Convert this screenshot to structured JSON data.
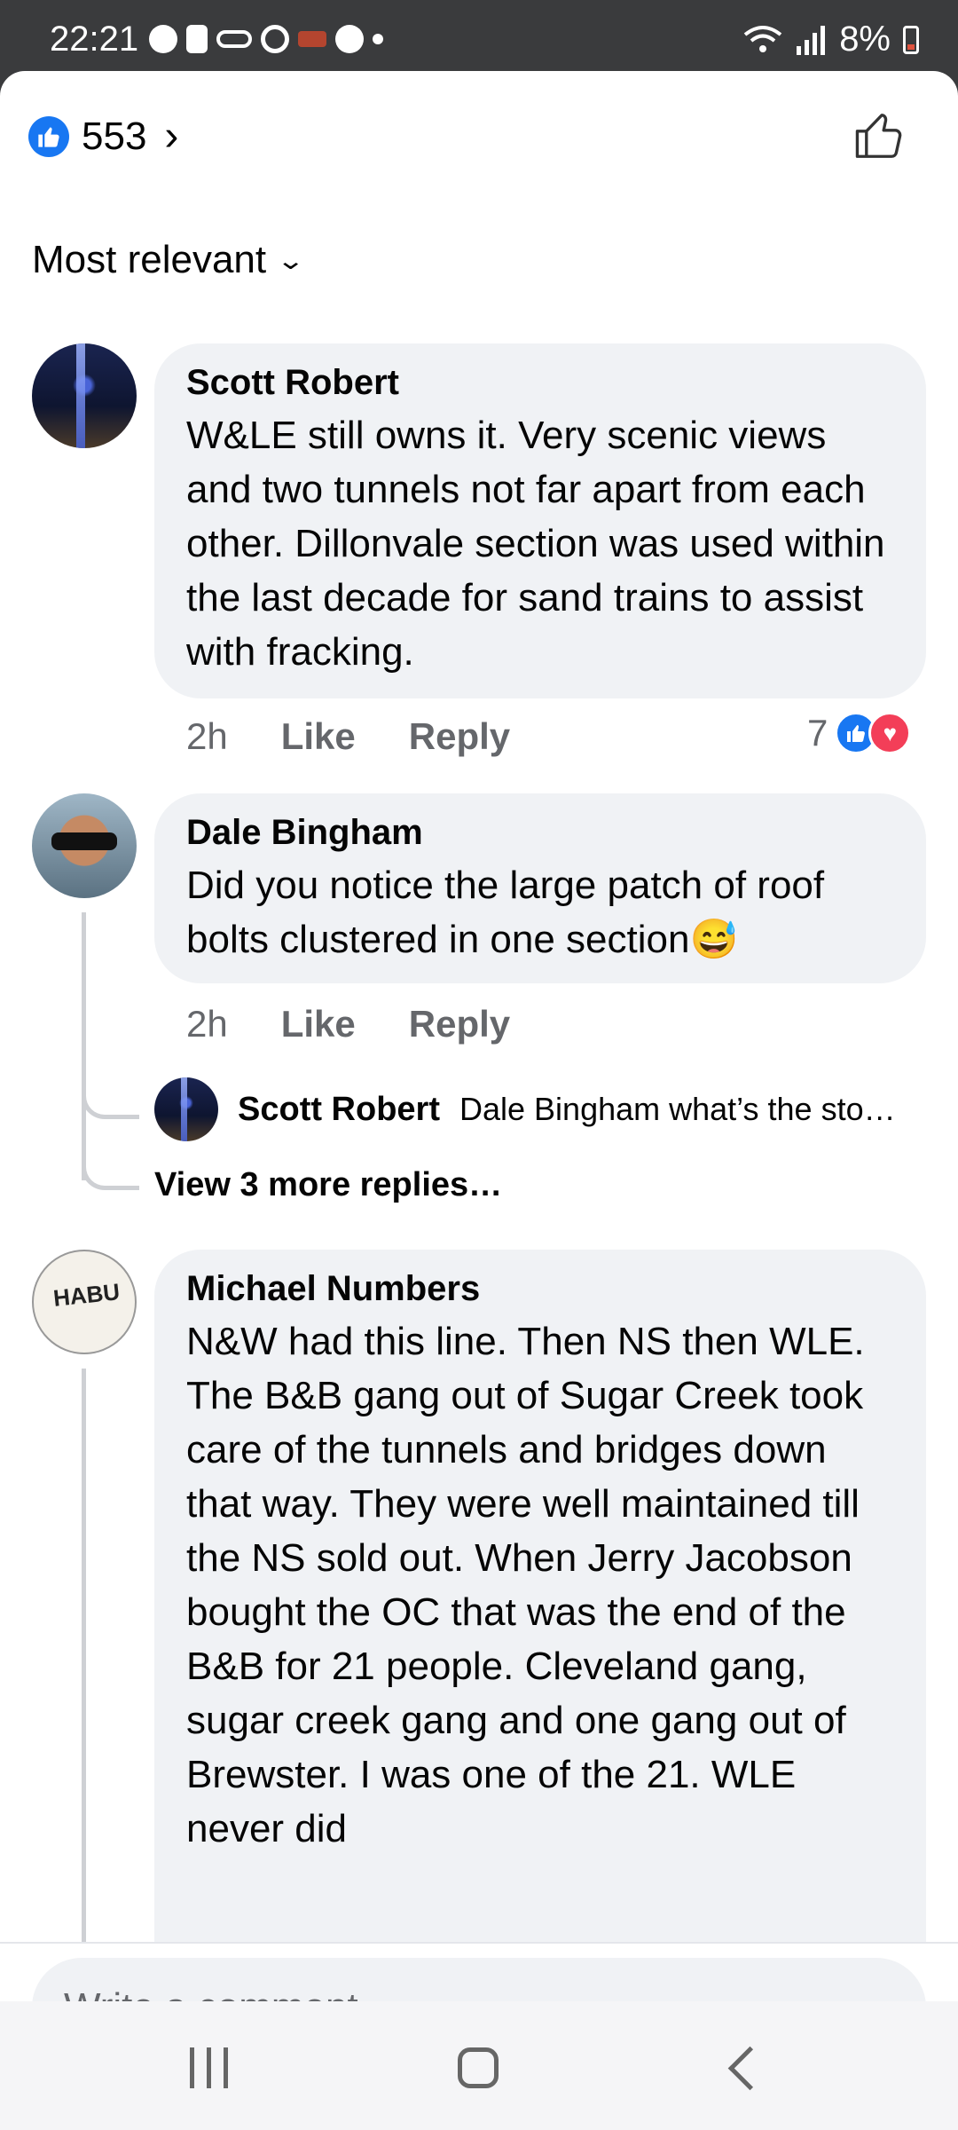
{
  "status_bar": {
    "time": "22:21",
    "battery": "8%",
    "icons": [
      "minus-circle-icon",
      "battery-saver-icon",
      "voicemail-icon",
      "ring-icon",
      "app-icon",
      "messenger-icon",
      "dot-icon",
      "wifi-icon",
      "signal-icon",
      "battery-icon"
    ]
  },
  "reactions": {
    "count": "553"
  },
  "sort": {
    "label": "Most relevant"
  },
  "comments": [
    {
      "author": "Scott Robert",
      "text": "W&LE still owns it.  Very scenic views and two tunnels not far apart from each other.  Dillonvale section was used within the last decade for sand trains to assist with fracking.",
      "time": "2h",
      "like_label": "Like",
      "reply_label": "Reply",
      "reaction_count": "7"
    },
    {
      "author": "Dale Bingham",
      "text": "Did you notice the large patch of roof bolts clustered in one section😅",
      "time": "2h",
      "like_label": "Like",
      "reply_label": "Reply",
      "reply_preview": {
        "author": "Scott Robert",
        "text": "Dale Bingham what’s the sto…"
      },
      "more_replies": "View 3 more replies…"
    },
    {
      "author": "Michael Numbers",
      "avatar_text": "HABU",
      "text": "N&W had this line. Then NS then WLE. The B&B gang out of Sugar Creek took care of the tunnels and bridges down that way. They were well maintained till the NS sold out. When Jerry Jacobson bought the OC that was the end of the B&B for 21 people. Cleveland gang, sugar creek gang and one gang out of Brewster. I was one of the 21. WLE never did"
    }
  ],
  "composer": {
    "placeholder": "Write a comment…"
  },
  "colors": {
    "accent": "#1877f2",
    "bubble": "#f0f2f5",
    "love": "#f33e58"
  }
}
